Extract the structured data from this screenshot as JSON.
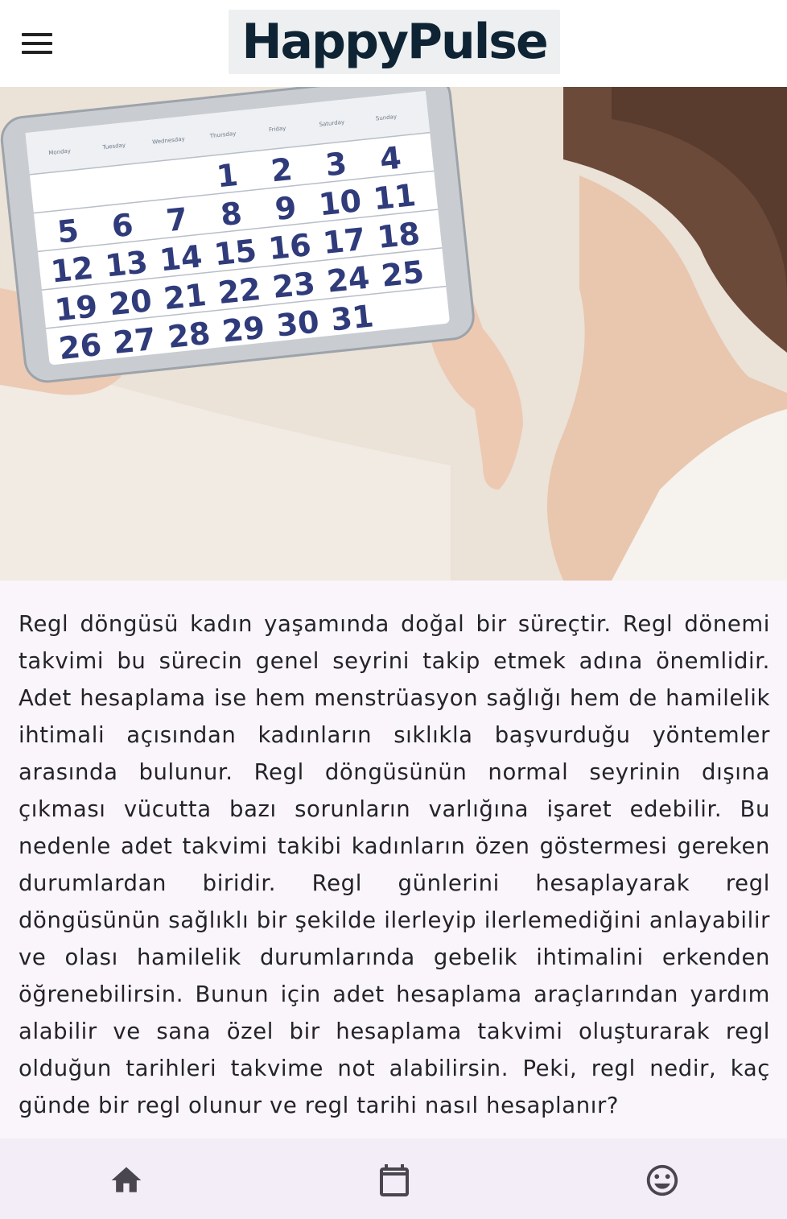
{
  "header": {
    "menu_icon": "hamburger-menu-icon",
    "logo_text": "HappyPulse"
  },
  "hero": {
    "calendar": {
      "weekdays": [
        "Monday",
        "Tuesday",
        "Wednesday",
        "Thursday",
        "Friday",
        "Saturday",
        "Sunday"
      ],
      "rows": [
        [
          "",
          "",
          "",
          "1",
          "2",
          "3",
          "4"
        ],
        [
          "5",
          "6",
          "7",
          "8",
          "9",
          "10",
          "11"
        ],
        [
          "12",
          "13",
          "14",
          "15",
          "16",
          "17",
          "18"
        ],
        [
          "19",
          "20",
          "21",
          "22",
          "23",
          "24",
          "25"
        ],
        [
          "26",
          "27",
          "28",
          "29",
          "30",
          "31",
          ""
        ]
      ]
    }
  },
  "article": {
    "body": "Regl döngüsü kadın yaşamında doğal bir süreçtir. Regl dönemi takvimi bu sürecin genel seyrini takip etmek adına önemlidir. Adet hesaplama ise hem menstrüasyon sağlığı hem de hamilelik ihtimali açısından kadınların sıklıkla başvurduğu yöntemler arasında bulunur. Regl döngüsünün normal seyrinin dışına çıkması vücutta bazı sorunların varlığına işaret edebilir. Bu nedenle adet takvimi takibi kadınların özen göstermesi gereken durumlardan biridir. Regl günlerini hesaplayarak regl döngüsünün sağlıklı bir şekilde ilerleyip ilerlemediğini anlayabilir ve olası hamilelik durumlarında gebelik ihtimalini erkenden öğrenebilirsin. Bunun için adet hesaplama araçlarından yardım alabilir ve sana özel bir hesaplama takvimi oluşturarak regl olduğun tarihleri takvime not alabilirsin. Peki, regl nedir, kaç günde bir regl olunur ve regl tarihi nasıl hesaplanır?"
  },
  "bottom_nav": {
    "items": [
      {
        "icon": "home-icon"
      },
      {
        "icon": "calendar-icon"
      },
      {
        "icon": "smiley-face-icon"
      }
    ],
    "icon_color": "#4a4650",
    "background": "#f3edf7"
  }
}
